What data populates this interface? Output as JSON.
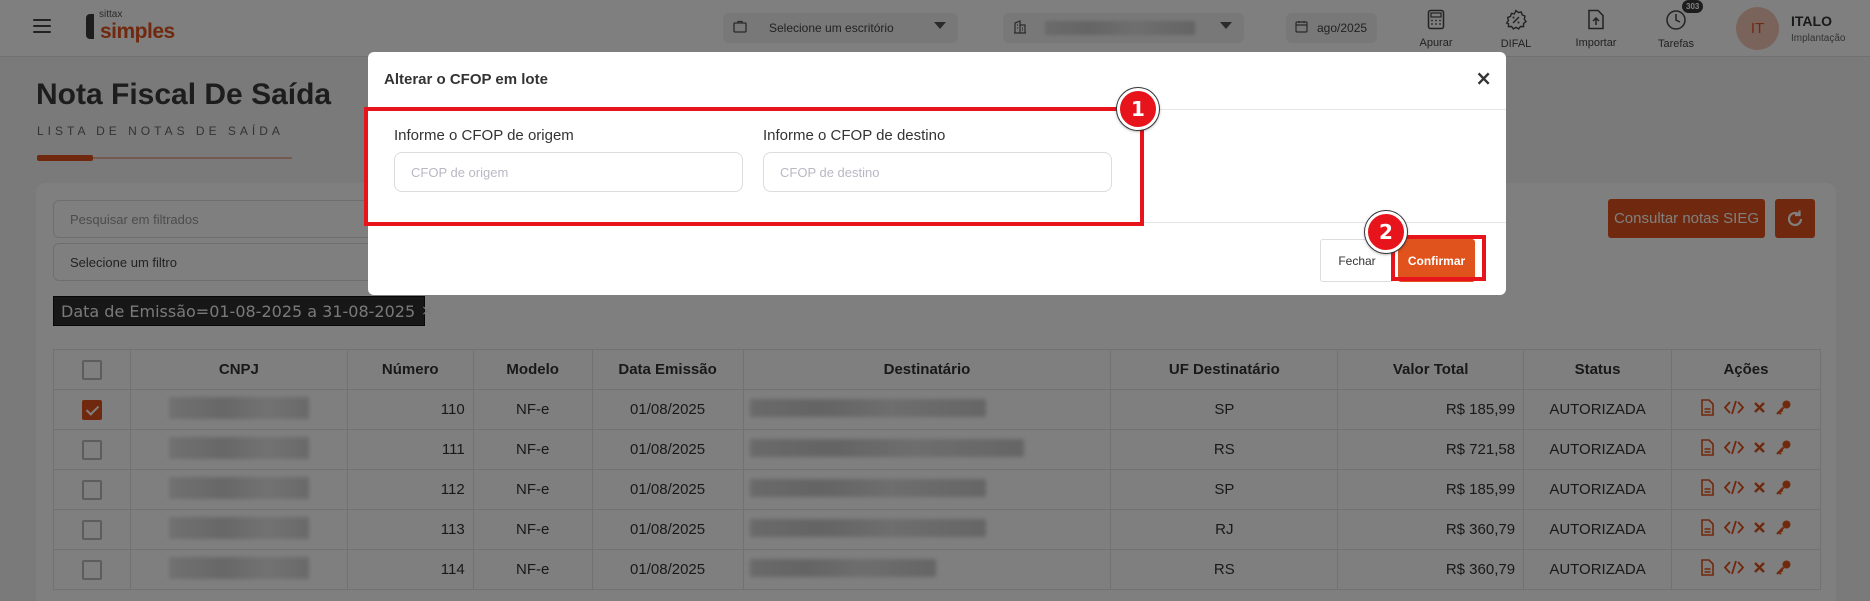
{
  "topbar": {
    "logo_small": "sittax",
    "logo_big": "simples",
    "office_placeholder": "Selecione um escritório",
    "period": "ago/2025",
    "tools": [
      {
        "label": "Apurar",
        "icon": "calculator-icon"
      },
      {
        "label": "DIFAL",
        "icon": "percent-badge-icon"
      },
      {
        "label": "Importar",
        "icon": "upload-file-icon"
      },
      {
        "label": "Tarefas",
        "icon": "clock-icon",
        "badge": "303"
      }
    ],
    "user_initials": "IT",
    "user_name": "ITALO",
    "user_role": "Implantação"
  },
  "page": {
    "title": "Nota Fiscal De Saída",
    "subtitle": "LISTA DE NOTAS DE SAÍDA"
  },
  "filters": {
    "search_placeholder": "Pesquisar em filtrados",
    "select_placeholder": "Selecione um filtro",
    "active_chip": "Data de Emissão=01-08-2025 a 31-08-2025",
    "chip_close": "×"
  },
  "actions": {
    "sieg_label": "Consultar notas SIEG"
  },
  "table": {
    "headers": [
      "CNPJ",
      "Número",
      "Modelo",
      "Data Emissão",
      "Destinatário",
      "UF Destinatário",
      "Valor Total",
      "Status",
      "Ações"
    ],
    "rows": [
      {
        "checked": true,
        "numero": "110",
        "modelo": "NF-e",
        "data": "01/08/2025",
        "uf": "SP",
        "valor": "R$ 185,99",
        "status": "AUTORIZADA"
      },
      {
        "checked": false,
        "numero": "111",
        "modelo": "NF-e",
        "data": "01/08/2025",
        "uf": "RS",
        "valor": "R$ 721,58",
        "status": "AUTORIZADA"
      },
      {
        "checked": false,
        "numero": "112",
        "modelo": "NF-e",
        "data": "01/08/2025",
        "uf": "SP",
        "valor": "R$ 185,99",
        "status": "AUTORIZADA"
      },
      {
        "checked": false,
        "numero": "113",
        "modelo": "NF-e",
        "data": "01/08/2025",
        "uf": "RJ",
        "valor": "R$ 360,79",
        "status": "AUTORIZADA"
      },
      {
        "checked": false,
        "numero": "114",
        "modelo": "NF-e",
        "data": "01/08/2025",
        "uf": "RS",
        "valor": "R$ 360,79",
        "status": "AUTORIZADA"
      }
    ]
  },
  "modal": {
    "title": "Alterar o CFOP em lote",
    "close": "×",
    "origem_label": "Informe o CFOP de origem",
    "origem_placeholder": "CFOP de origem",
    "destino_label": "Informe o CFOP de destino",
    "destino_placeholder": "CFOP de destino",
    "fechar_label": "Fechar",
    "confirmar_label": "Confirmar"
  },
  "annotations": {
    "marker_1": "1",
    "marker_2": "2"
  },
  "colors": {
    "accent": "#e0531c",
    "highlight": "#e8141c",
    "overlay": "rgba(0,0,0,0.5)"
  }
}
